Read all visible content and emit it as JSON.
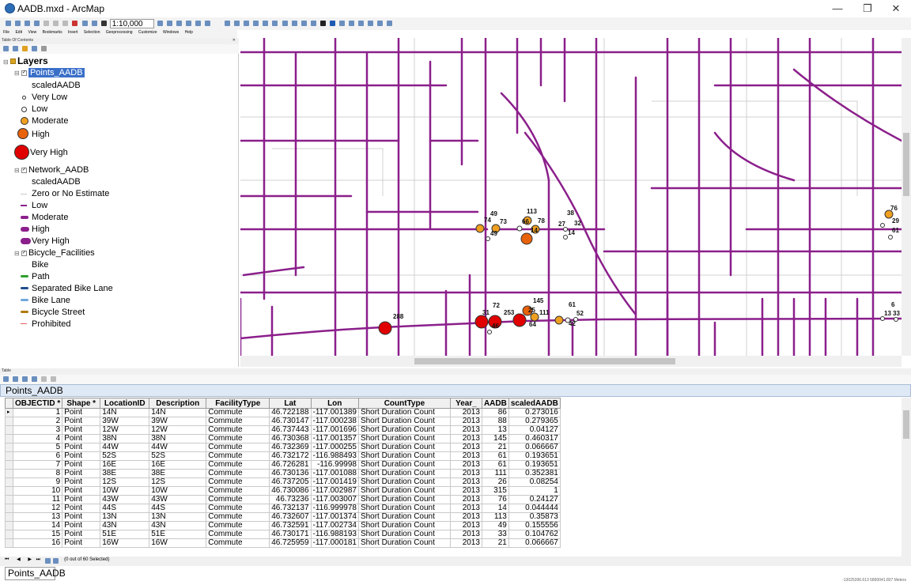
{
  "window": {
    "title": "AADB.mxd - ArcMap",
    "minimize": "—",
    "maximize": "❐",
    "close": "✕"
  },
  "toolbar": {
    "scale": "1:10,000"
  },
  "menu": [
    "File",
    "Edit",
    "View",
    "Bookmarks",
    "Insert",
    "Selection",
    "Geoprocessing",
    "Customize",
    "Windows",
    "Help"
  ],
  "toc": {
    "panel_title": "Table Of Contents",
    "layers_label": "Layers",
    "points_layer": {
      "name": "Points_AADB",
      "field": "scaledAADB",
      "classes": [
        "Very Low",
        "Low",
        "Moderate",
        "High",
        "Very High"
      ]
    },
    "network_layer": {
      "name": "Network_AADB",
      "field": "scaledAADB",
      "classes": [
        "Zero or No Estimate",
        "Low",
        "Moderate",
        "High",
        "Very High"
      ]
    },
    "bike_layer": {
      "name": "Bicycle_Facilities",
      "field": "Bike",
      "classes": [
        "Path",
        "Separated Bike Lane",
        "Bike Lane",
        "Bicycle Street",
        "Prohibited"
      ]
    }
  },
  "colors": {
    "road": "#8b1f8b",
    "minor_road": "#c9c9c9",
    "very_high": "#e00000",
    "high": "#e8620a",
    "moderate": "#f0a020",
    "low": "#ffffff",
    "path": "#2ca02c",
    "separated": "#1f4e8c",
    "bike_lane": "#6fa8dc",
    "bicycle_street": "#b07a10",
    "prohibited": "#e06060"
  },
  "map_labels": [
    "49",
    "73",
    "113",
    "38",
    "74",
    "66",
    "78",
    "27",
    "32",
    "49",
    "14",
    "14",
    "76",
    "29",
    "61",
    "288",
    "72",
    "145",
    "61",
    "31",
    "253",
    "25",
    "111",
    "52",
    "46",
    "64",
    "42",
    "6",
    "13",
    "33"
  ],
  "table": {
    "panel_title": "Table",
    "layer": "Points_AADB",
    "columns": [
      "OBJECTID *",
      "Shape *",
      "LocationID",
      "Description",
      "FacilityType",
      "Lat",
      "Lon",
      "CountType",
      "Year_",
      "AADB",
      "scaledAADB"
    ],
    "rows": [
      [
        "1",
        "Point",
        "14N",
        "14N",
        "Commute",
        "46.722188",
        "-117.001389",
        "Short Duration Count",
        "2013",
        "86",
        "0.273016"
      ],
      [
        "2",
        "Point",
        "39W",
        "39W",
        "Commute",
        "46.730147",
        "-117.000238",
        "Short Duration Count",
        "2013",
        "88",
        "0.279365"
      ],
      [
        "3",
        "Point",
        "12W",
        "12W",
        "Commute",
        "46.737443",
        "-117.001696",
        "Short Duration Count",
        "2013",
        "13",
        "0.04127"
      ],
      [
        "4",
        "Point",
        "38N",
        "38N",
        "Commute",
        "46.730368",
        "-117.001357",
        "Short Duration Count",
        "2013",
        "145",
        "0.460317"
      ],
      [
        "5",
        "Point",
        "44W",
        "44W",
        "Commute",
        "46.732369",
        "-117.000255",
        "Short Duration Count",
        "2013",
        "21",
        "0.066667"
      ],
      [
        "6",
        "Point",
        "52S",
        "52S",
        "Commute",
        "46.732172",
        "-116.988493",
        "Short Duration Count",
        "2013",
        "61",
        "0.193651"
      ],
      [
        "7",
        "Point",
        "16E",
        "16E",
        "Commute",
        "46.726281",
        "-116.99998",
        "Short Duration Count",
        "2013",
        "61",
        "0.193651"
      ],
      [
        "8",
        "Point",
        "38E",
        "38E",
        "Commute",
        "46.730136",
        "-117.001088",
        "Short Duration Count",
        "2013",
        "111",
        "0.352381"
      ],
      [
        "9",
        "Point",
        "12S",
        "12S",
        "Commute",
        "46.737205",
        "-117.001419",
        "Short Duration Count",
        "2013",
        "26",
        "0.08254"
      ],
      [
        "10",
        "Point",
        "10W",
        "10W",
        "Commute",
        "46.730086",
        "-117.002987",
        "Short Duration Count",
        "2013",
        "315",
        "1"
      ],
      [
        "11",
        "Point",
        "43W",
        "43W",
        "Commute",
        "46.73236",
        "-117.003007",
        "Short Duration Count",
        "2013",
        "76",
        "0.24127"
      ],
      [
        "12",
        "Point",
        "44S",
        "44S",
        "Commute",
        "46.732137",
        "-116.999978",
        "Short Duration Count",
        "2013",
        "14",
        "0.044444"
      ],
      [
        "13",
        "Point",
        "13N",
        "13N",
        "Commute",
        "46.732607",
        "-117.001374",
        "Short Duration Count",
        "2013",
        "113",
        "0.35873"
      ],
      [
        "14",
        "Point",
        "43N",
        "43N",
        "Commute",
        "46.732591",
        "-117.002734",
        "Short Duration Count",
        "2013",
        "49",
        "0.155556"
      ],
      [
        "15",
        "Point",
        "51E",
        "51E",
        "Commute",
        "46.730171",
        "-116.988193",
        "Short Duration Count",
        "2013",
        "33",
        "0.104762"
      ],
      [
        "16",
        "Point",
        "16W",
        "16W",
        "Commute",
        "46.725959",
        "-117.000181",
        "Short Duration Count",
        "2013",
        "21",
        "0.066667"
      ]
    ],
    "selection_status": "(0 out of 60 Selected)"
  },
  "bottom_tab": "Points_AADB",
  "coords": "-13025396.613  5890041.807 Meters"
}
